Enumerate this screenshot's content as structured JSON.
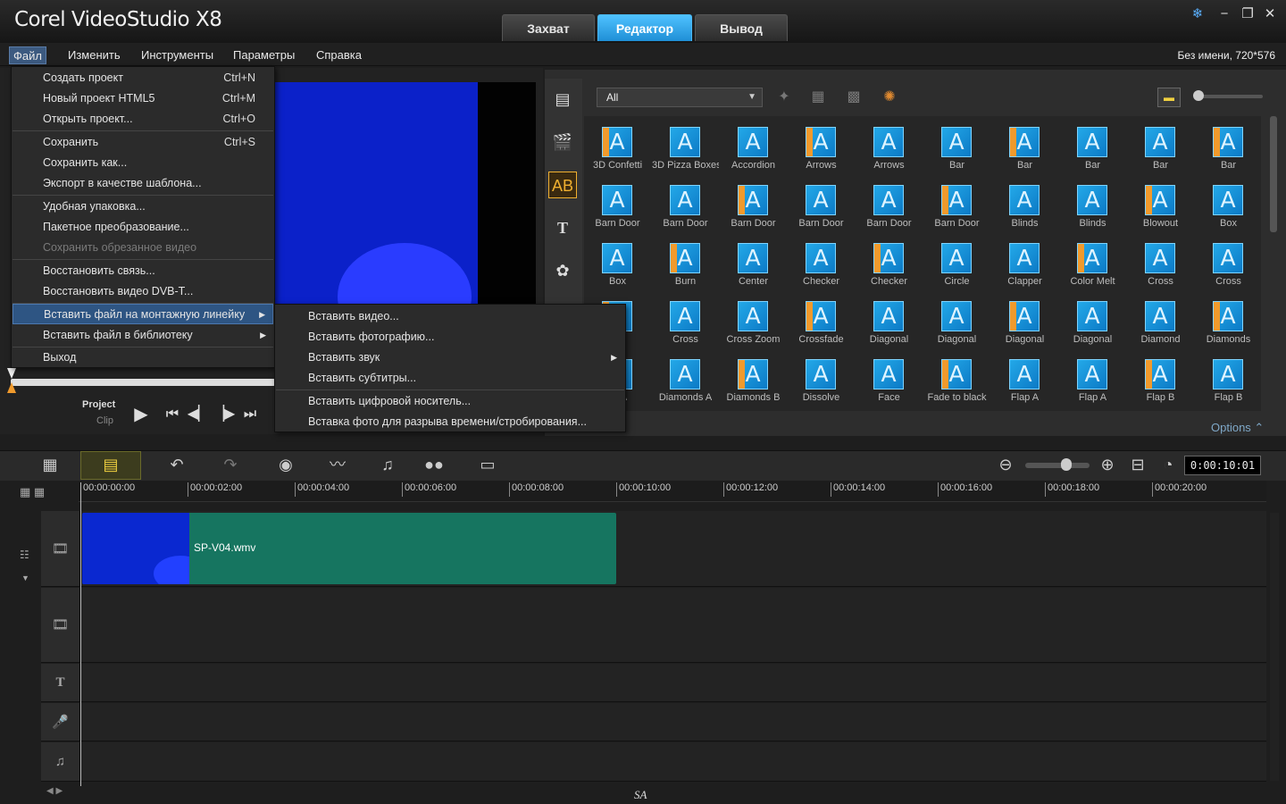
{
  "app": {
    "title": "Corel VideoStudio X8",
    "project_info": "Без имени, 720*576"
  },
  "tabs": [
    {
      "label": "Захват"
    },
    {
      "label": "Редактор"
    },
    {
      "label": "Вывод"
    }
  ],
  "window": {
    "minimize": "−",
    "restore": "❐",
    "close": "✕",
    "help": "❄"
  },
  "menubar": {
    "items": [
      "Файл",
      "Изменить",
      "Инструменты",
      "Параметры",
      "Справка"
    ]
  },
  "file_menu": {
    "items": [
      {
        "label": "Создать проект",
        "shortcut": "Ctrl+N"
      },
      {
        "label": "Новый проект HTML5",
        "shortcut": "Ctrl+M"
      },
      {
        "label": "Открыть проект...",
        "shortcut": "Ctrl+O"
      },
      {
        "label": "Сохранить",
        "shortcut": "Ctrl+S"
      },
      {
        "label": "Сохранить как...",
        "shortcut": ""
      },
      {
        "label": "Экспорт в качестве шаблона...",
        "shortcut": ""
      },
      {
        "label": "Удобная упаковка...",
        "shortcut": ""
      },
      {
        "label": "Пакетное преобразование...",
        "shortcut": ""
      },
      {
        "label": "Сохранить обрезанное видео",
        "shortcut": ""
      },
      {
        "label": "Восстановить связь...",
        "shortcut": ""
      },
      {
        "label": "Восстановить видео DVB-T...",
        "shortcut": ""
      },
      {
        "label": "Вставить файл на монтажную линейку",
        "shortcut": ""
      },
      {
        "label": "Вставить файл в библиотеку",
        "shortcut": ""
      },
      {
        "label": "Выход",
        "shortcut": ""
      }
    ]
  },
  "submenu": {
    "items": [
      {
        "label": "Вставить видео..."
      },
      {
        "label": "Вставить фотографию..."
      },
      {
        "label": "Вставить звук"
      },
      {
        "label": "Вставить субтитры..."
      },
      {
        "label": "Вставить цифровой носитель..."
      },
      {
        "label": "Вставка фото для разрыва времени/стробирования..."
      }
    ]
  },
  "library": {
    "filter": "All",
    "options": "Options ⌃",
    "transitions": [
      [
        "3D Confetti",
        "3D Pizza Boxes",
        "Accordion",
        "Arrows",
        "Arrows",
        "Bar",
        "Bar",
        "Bar",
        "Bar",
        "Bar"
      ],
      [
        "Barn Door",
        "Barn Door",
        "Barn Door",
        "Barn Door",
        "Barn Door",
        "Barn Door",
        "Blinds",
        "Blinds",
        "Blowout",
        "Box"
      ],
      [
        "Box",
        "Burn",
        "Center",
        "Checker",
        "Checker",
        "Circle",
        "Clapper",
        "Color Melt",
        "Cross",
        "Cross"
      ],
      [
        "",
        "Cross",
        "Cross Zoom",
        "Crossfade",
        "Diagonal",
        "Diagonal",
        "Diagonal",
        "Diagonal",
        "Diamond",
        "Diamonds"
      ],
      [
        "ds A",
        "Diamonds A",
        "Diamonds B",
        "Dissolve",
        "Face",
        "Fade to black",
        "Flap A",
        "Flap A",
        "Flap B",
        "Flap B"
      ]
    ],
    "thumb_glyph": "A"
  },
  "player": {
    "project": "Project",
    "clip": "Clip"
  },
  "timeline": {
    "timecode": "0:00:10:01",
    "ruler": [
      "00:00:00:00",
      "00:00:02:00",
      "00:00:04:00",
      "00:00:06:00",
      "00:00:08:00",
      "00:00:10:00",
      "00:00:12:00",
      "00:00:14:00",
      "00:00:16:00",
      "00:00:18:00",
      "00:00:20:00"
    ],
    "clip_name": "SP-V04.wmv",
    "watermark": "SA"
  }
}
